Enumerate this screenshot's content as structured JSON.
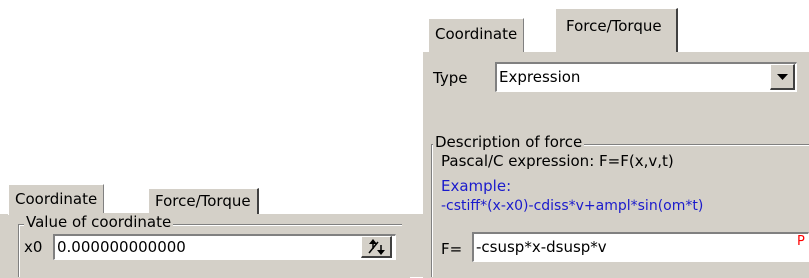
{
  "left_dialog": {
    "tabs": [
      "Coordinate",
      "Force/Torque"
    ],
    "active_tab": "Coordinate",
    "group_title": "Value of coordinate",
    "x0_label": "x0",
    "x0_value": "0.000000000000",
    "spin_icon": "spin-updown-icon"
  },
  "right_dialog": {
    "tabs": [
      "Coordinate",
      "Force/Torque"
    ],
    "active_tab": "Force/Torque",
    "type_label": "Type",
    "type_value": "Expression",
    "dropdown_icon": "chevron-down-icon",
    "group_title": "Description of force",
    "expression_hint": "Pascal/C expression: F=F(x,v,t)",
    "example_label": "Example:",
    "example_text": "-cstiff*(x-x0)-cdiss*v+ampl*sin(om*t)",
    "f_label": "F=",
    "f_value": "-csusp*x-dsusp*v",
    "f_marker": "P",
    "example_color": "#1a1acc",
    "marker_color": "#ff0000"
  }
}
